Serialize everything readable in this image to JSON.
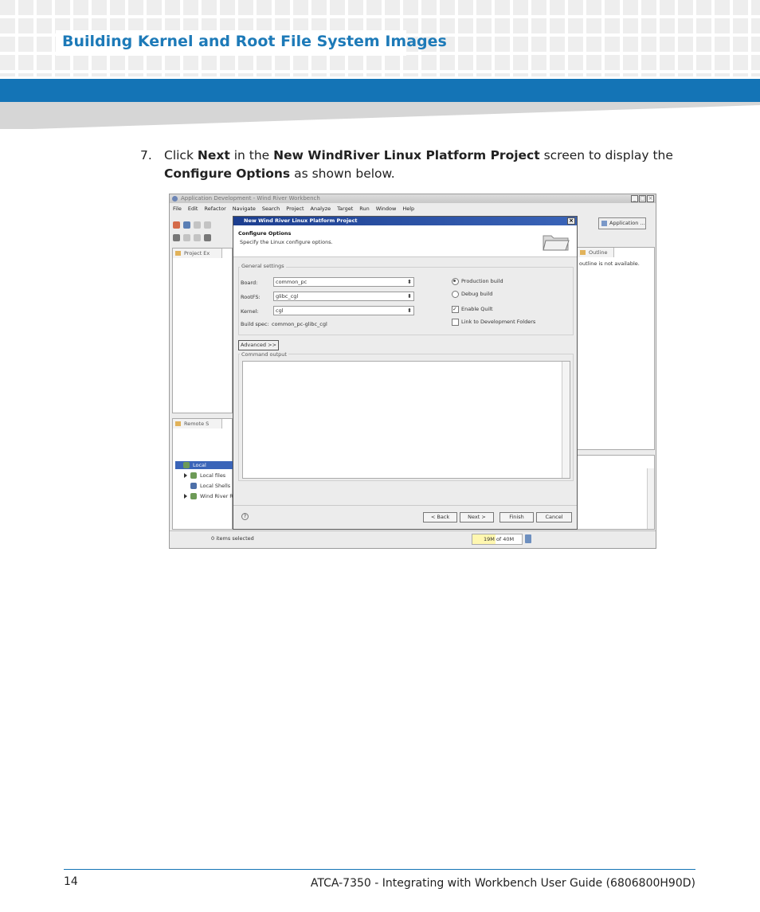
{
  "header": {
    "title": "Building Kernel and Root File System Images",
    "brand_color": "#1474b6"
  },
  "step": {
    "number": "7.",
    "t1": "Click ",
    "b1": "Next",
    "t2": " in the ",
    "b2": "New WindRiver Linux Platform Project",
    "t3": " screen to display the ",
    "b3": "Configure Options",
    "t4": " as shown below."
  },
  "screenshot": {
    "window_title": "Application Development - Wind River Workbench",
    "window_buttons": [
      "_",
      "□",
      "×"
    ],
    "menu": [
      "File",
      "Edit",
      "Refactor",
      "Navigate",
      "Search",
      "Project",
      "Analyze",
      "Target",
      "Run",
      "Window",
      "Help"
    ],
    "perspective_button": "Application ...",
    "project_tab": "Project Ex",
    "remote_tab": "Remote S",
    "outline_tab": "Outline",
    "outline_message": "outline is not available.",
    "tree": {
      "root": "Local",
      "items": [
        "Local files",
        "Local Shells",
        "Wind River R"
      ]
    },
    "status": {
      "selection": "0 items selected",
      "heap": "19M of 40M",
      "heap_fraction": 0.475
    },
    "dialog": {
      "title": "New Wind River Linux Platform Project",
      "heading": "Configure Options",
      "subheading": "Specify the Linux configure options.",
      "group_label": "General settings",
      "fields": [
        {
          "label": "Board:",
          "value": "common_pc"
        },
        {
          "label": "RootFS:",
          "value": "glibc_cgl"
        },
        {
          "label": "Kernel:",
          "value": "cgl"
        }
      ],
      "build_spec_label": "Build spec:",
      "build_spec_value": "common_pc-glibc_cgl",
      "options": [
        {
          "label": "Production build",
          "type": "radio",
          "checked": true
        },
        {
          "label": "Debug build",
          "type": "radio",
          "checked": false
        },
        {
          "label": "Enable Quilt",
          "type": "checkbox",
          "checked": true
        },
        {
          "label": "Link to Development Folders",
          "type": "checkbox",
          "checked": false
        }
      ],
      "advanced_button": "Advanced >>",
      "output_label": "Command output",
      "help_icon": "?",
      "buttons": [
        "< Back",
        "Next >",
        "Finish",
        "Cancel"
      ]
    }
  },
  "footer": {
    "page_number": "14",
    "doc_title": "ATCA-7350 - Integrating with Workbench User Guide (6806800H90D)"
  }
}
